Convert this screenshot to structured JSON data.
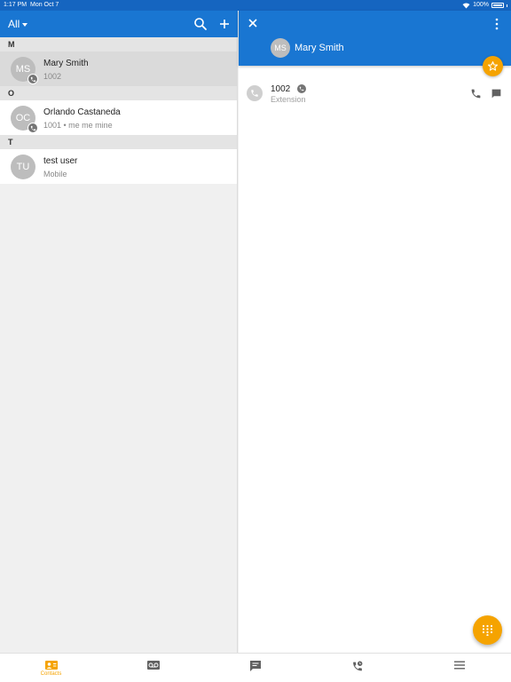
{
  "status_bar": {
    "time": "1:17 PM",
    "date": "Mon Oct 7",
    "battery": "100%"
  },
  "list_header": {
    "filter_label": "All",
    "icons": [
      "search-icon",
      "plus-icon"
    ]
  },
  "sections": [
    {
      "letter": "M",
      "contacts": [
        {
          "initials": "MS",
          "name": "Mary Smith",
          "subtitle": "1002",
          "selected": true
        }
      ]
    },
    {
      "letter": "O",
      "contacts": [
        {
          "initials": "OC",
          "name": "Orlando Castaneda",
          "subtitle": "1001 • me me mine",
          "selected": false
        }
      ]
    },
    {
      "letter": "T",
      "contacts": [
        {
          "initials": "TU",
          "name": "test user",
          "subtitle": "Mobile",
          "selected": false
        }
      ]
    }
  ],
  "detail": {
    "initials": "MS",
    "name": "Mary Smith",
    "entries": [
      {
        "number": "1002",
        "type": "Extension"
      }
    ]
  },
  "bottom_nav": {
    "tabs": [
      {
        "icon": "contacts-icon",
        "label": "Contacts",
        "active": true
      },
      {
        "icon": "voicemail-icon",
        "label": "",
        "active": false
      },
      {
        "icon": "chat-icon",
        "label": "",
        "active": false
      },
      {
        "icon": "call-history-icon",
        "label": "",
        "active": false
      },
      {
        "icon": "menu-icon",
        "label": "",
        "active": false
      }
    ]
  },
  "colors": {
    "header_blue": "#1976d2",
    "status_blue": "#1565c0",
    "accent_orange": "#f5a300"
  }
}
